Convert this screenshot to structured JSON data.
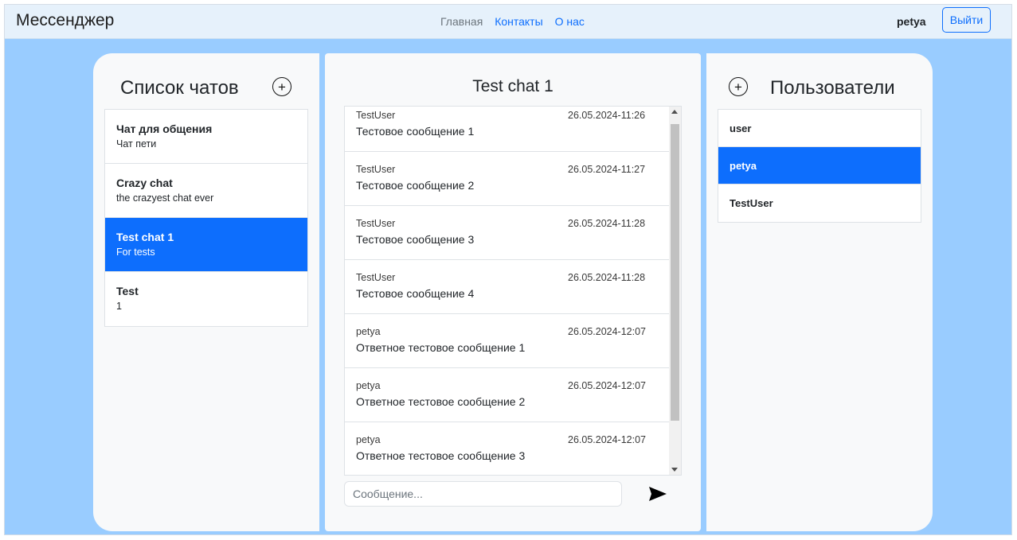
{
  "navbar": {
    "brand": "Мессенджер",
    "links": [
      "Главная",
      "Контакты",
      "О нас"
    ],
    "username": "petya",
    "logout_label": "Выйти"
  },
  "chats_panel": {
    "title": "Список чатов",
    "add_icon": "plus-circle-icon",
    "items": [
      {
        "name": "Чат для общения",
        "description": "Чат пети",
        "active": false
      },
      {
        "name": "Crazy chat",
        "description": "the crazyest chat ever",
        "active": false
      },
      {
        "name": "Test chat 1",
        "description": "For tests",
        "active": true
      },
      {
        "name": "Test",
        "description": "1",
        "active": false
      }
    ]
  },
  "chat": {
    "title": "Test chat 1",
    "messages": [
      {
        "author": "TestUser",
        "time": "26.05.2024-11:26",
        "text": "Тестовое сообщение 1"
      },
      {
        "author": "TestUser",
        "time": "26.05.2024-11:27",
        "text": "Тестовое сообщение 2"
      },
      {
        "author": "TestUser",
        "time": "26.05.2024-11:28",
        "text": "Тестовое сообщение 3"
      },
      {
        "author": "TestUser",
        "time": "26.05.2024-11:28",
        "text": "Тестовое сообщение 4"
      },
      {
        "author": "petya",
        "time": "26.05.2024-12:07",
        "text": "Ответное тестовое сообщение 1"
      },
      {
        "author": "petya",
        "time": "26.05.2024-12:07",
        "text": "Ответное тестовое сообщение 2"
      },
      {
        "author": "petya",
        "time": "26.05.2024-12:07",
        "text": "Ответное тестовое сообщение 3"
      }
    ],
    "input_placeholder": "Сообщение...",
    "send_icon": "send-icon"
  },
  "users_panel": {
    "title": "Пользователи",
    "add_icon": "plus-circle-icon",
    "items": [
      {
        "name": "user",
        "active": false
      },
      {
        "name": "petya",
        "active": true
      },
      {
        "name": "TestUser",
        "active": false
      }
    ]
  },
  "colors": {
    "page_background": "#99ccff",
    "navbar_background": "#e6f1fb",
    "panel_background": "#f8f9fa",
    "accent": "#0d6efd"
  }
}
